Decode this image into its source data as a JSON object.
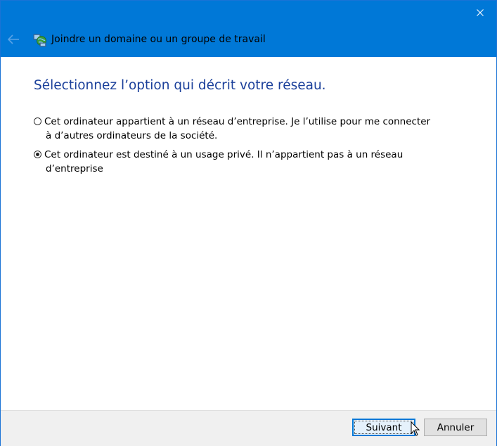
{
  "window": {
    "title": "Joindre un domaine ou un groupe de travail",
    "close_symbol": "✕",
    "back_symbol": "←",
    "accent_color": "#0078d7"
  },
  "main": {
    "heading": "Sélectionnez l’option qui décrit votre réseau.",
    "options": [
      {
        "line1": "Cet ordinateur appartient à un réseau d’entreprise. Je l’utilise pour me connecter",
        "line2": "à d’autres ordinateurs de la société.",
        "checked": false
      },
      {
        "line1": "Cet ordinateur est destiné à un usage privé. Il n’appartient pas à un réseau",
        "line2": "d’entreprise",
        "checked": true
      }
    ]
  },
  "footer": {
    "next_label": "Suivant",
    "cancel_label": "Annuler"
  },
  "icons": {
    "app": "network-globe-icon",
    "back": "back-arrow-icon",
    "close": "close-icon",
    "cursor": "mouse-pointer-icon"
  }
}
